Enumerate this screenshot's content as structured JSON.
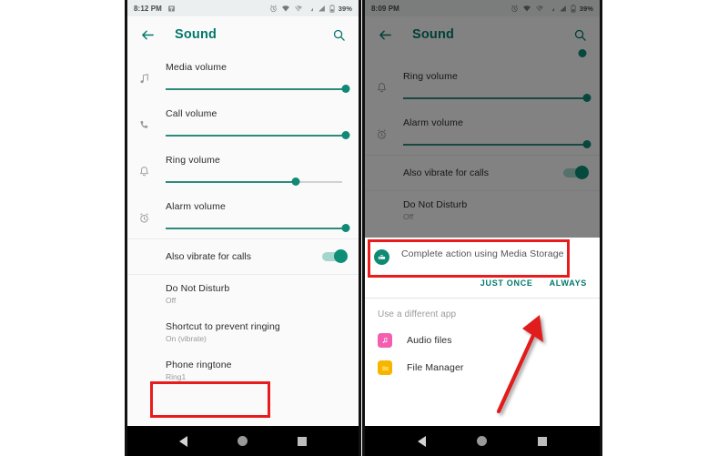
{
  "screenshot": {
    "title": "Android Sound settings — Phone ringtone and Complete action using Media Storage",
    "colors": {
      "accent_teal": "#00796b",
      "slider_teal": "#0f8a74",
      "highlight_red": "#e81c1c",
      "audio_app_pink": "#f45eb0",
      "file_manager_yellow": "#f7b500",
      "scrim": "rgba(0,0,0,0.48)"
    }
  },
  "left_phone": {
    "status_bar": {
      "clock": "8:12 PM",
      "battery_percent": "39%",
      "icons": [
        "screenshot-icon",
        "alarm-icon",
        "wifi-icon",
        "no-sim-icon",
        "signal-1-icon",
        "signal-2-icon",
        "battery-icon"
      ]
    },
    "app_bar": {
      "back_label": "back-arrow",
      "title": "Sound",
      "search_label": "search"
    },
    "volumes": [
      {
        "icon": "music-note-icon",
        "label": "Media volume",
        "value": 100
      },
      {
        "icon": "phone-icon",
        "label": "Call volume",
        "value": 100
      },
      {
        "icon": "bell-icon",
        "label": "Ring volume",
        "value": 72
      },
      {
        "icon": "alarm-clock-icon",
        "label": "Alarm volume",
        "value": 100
      }
    ],
    "vibrate": {
      "label": "Also vibrate for calls",
      "state": "on"
    },
    "preferences": [
      {
        "title": "Do Not Disturb",
        "subtitle": "Off",
        "highlighted": false
      },
      {
        "title": "Shortcut to prevent ringing",
        "subtitle": "On (vibrate)",
        "highlighted": false
      },
      {
        "title": "Phone ringtone",
        "subtitle": "Ring1",
        "highlighted": true
      }
    ],
    "nav_bar": {
      "back": "back-triangle",
      "home": "home-circle",
      "recents": "recents-square"
    }
  },
  "right_phone": {
    "status_bar": {
      "clock": "8:09 PM",
      "battery_percent": "39%",
      "icons": [
        "alarm-icon",
        "wifi-icon",
        "no-sim-icon",
        "signal-1-icon",
        "signal-2-icon",
        "battery-icon"
      ]
    },
    "app_bar": {
      "back_label": "back-arrow",
      "title": "Sound",
      "search_label": "search"
    },
    "volumes": [
      {
        "icon": "bell-icon",
        "label": "Ring volume",
        "value": 100
      },
      {
        "icon": "alarm-clock-icon",
        "label": "Alarm volume",
        "value": 100
      }
    ],
    "vibrate": {
      "label": "Also vibrate for calls",
      "state": "on"
    },
    "preferences": [
      {
        "title": "Do Not Disturb",
        "subtitle": "Off"
      }
    ],
    "dialog": {
      "icon": "media-storage-icon",
      "prompt": "Complete action using Media Storage",
      "buttons": {
        "just_once": "JUST ONCE",
        "always": "ALWAYS"
      },
      "different_app_header": "Use a different app",
      "apps": [
        {
          "icon": "audio-files-icon",
          "name": "Audio files"
        },
        {
          "icon": "file-manager-icon",
          "name": "File Manager"
        }
      ]
    },
    "nav_bar": {
      "back": "back-triangle",
      "home": "home-circle",
      "recents": "recents-square"
    }
  },
  "annotations": {
    "boxes": [
      {
        "name": "phone-ringtone-highlight",
        "target": "Phone ringtone"
      },
      {
        "name": "complete-action-highlight",
        "target": "Complete action using Media Storage"
      }
    ],
    "arrow": {
      "name": "always-button-arrow",
      "points_to": "ALWAYS"
    }
  }
}
